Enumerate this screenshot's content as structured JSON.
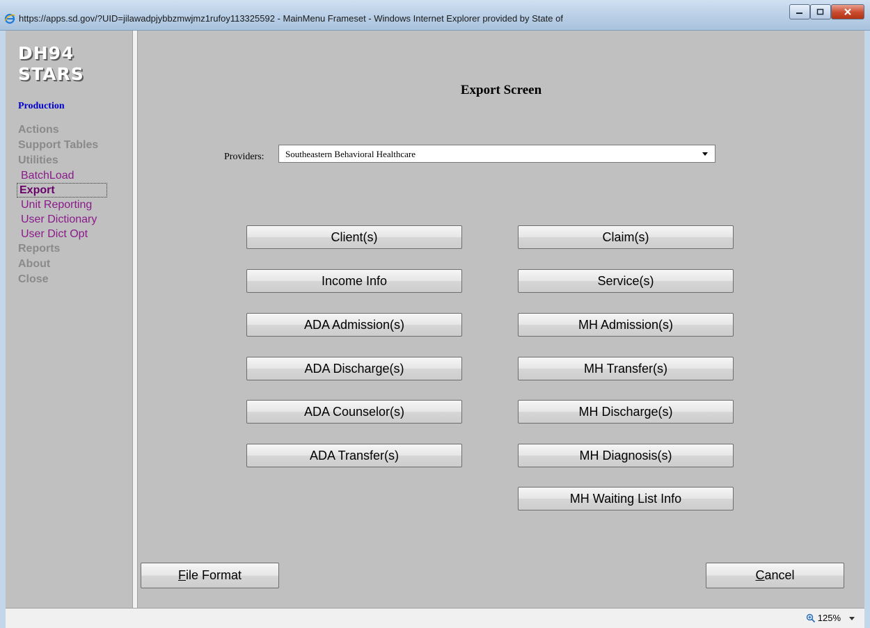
{
  "window": {
    "title": "https://apps.sd.gov/?UID=jilawadpjybbzmwjmz1rufoy113325592 - MainMenu Frameset - Windows Internet Explorer provided by State of",
    "browser_icon": "ie-icon",
    "controls": [
      "minimize",
      "maximize",
      "close"
    ]
  },
  "sidebar": {
    "logo_line1": "DH94",
    "logo_line2": "STARS",
    "environment": "Production",
    "menu": [
      {
        "label": "Actions"
      },
      {
        "label": "Support Tables"
      },
      {
        "label": "Utilities"
      }
    ],
    "submenu": [
      {
        "label": "BatchLoad"
      },
      {
        "label": "Export"
      },
      {
        "label": "Unit Reporting"
      },
      {
        "label": "User Dictionary"
      },
      {
        "label": "User Dict Opt"
      }
    ],
    "menu_bottom": [
      {
        "label": "Reports"
      },
      {
        "label": "About"
      },
      {
        "label": "Close"
      }
    ]
  },
  "main": {
    "title": "Export Screen",
    "providers_label": "Providers:",
    "providers_value": "Southeastern Behavioral Healthcare",
    "left_buttons": [
      "Client(s)",
      "Income Info",
      "ADA Admission(s)",
      "ADA Discharge(s)",
      "ADA Counselor(s)",
      "ADA Transfer(s)"
    ],
    "right_buttons": [
      "Claim(s)",
      "Service(s)",
      "MH Admission(s)",
      "MH Transfer(s)",
      "MH Discharge(s)",
      "MH Diagnosis(s)",
      "MH Waiting List Info"
    ],
    "file_format": {
      "accel": "F",
      "rest": "ile Format"
    },
    "cancel": {
      "accel": "C",
      "rest": "ancel"
    }
  },
  "statusbar": {
    "zoom": "125%"
  },
  "colors": {
    "background": "#c0c0c0",
    "environment": "#0000cc",
    "submenu": "#8a1a8a",
    "menu": "#8a8a8a"
  }
}
